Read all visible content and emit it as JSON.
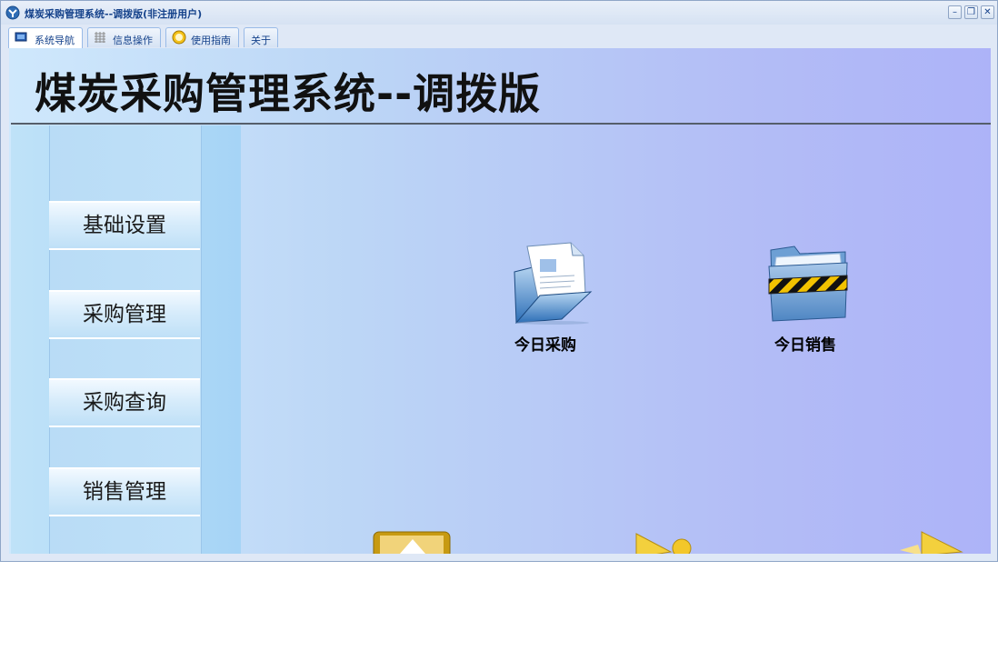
{
  "window": {
    "title": "煤炭采购管理系统--调拨版(非注册用户)",
    "controls": {
      "minimize": "–",
      "restore": "❐",
      "close": "✕"
    }
  },
  "tabs": [
    {
      "label": "系统导航",
      "icon": "monitor-icon",
      "active": true
    },
    {
      "label": "信息操作",
      "icon": "grid-icon",
      "active": false
    },
    {
      "label": "使用指南",
      "icon": "help-globe-icon",
      "active": false
    },
    {
      "label": "关于",
      "icon": "",
      "active": false
    }
  ],
  "banner": {
    "title": "煤炭采购管理系统--调拨版"
  },
  "sidebar": {
    "items": [
      {
        "label": "基础设置"
      },
      {
        "label": "采购管理"
      },
      {
        "label": "采购查询"
      },
      {
        "label": "销售管理"
      }
    ]
  },
  "main": {
    "icons": [
      {
        "label": "今日采购",
        "icon": "document-folder-icon"
      },
      {
        "label": "今日销售",
        "icon": "caution-folder-icon"
      }
    ]
  },
  "colors": {
    "title_text": "#15428b",
    "accent": "#99bbe8",
    "banner_line": "#555e6a"
  }
}
